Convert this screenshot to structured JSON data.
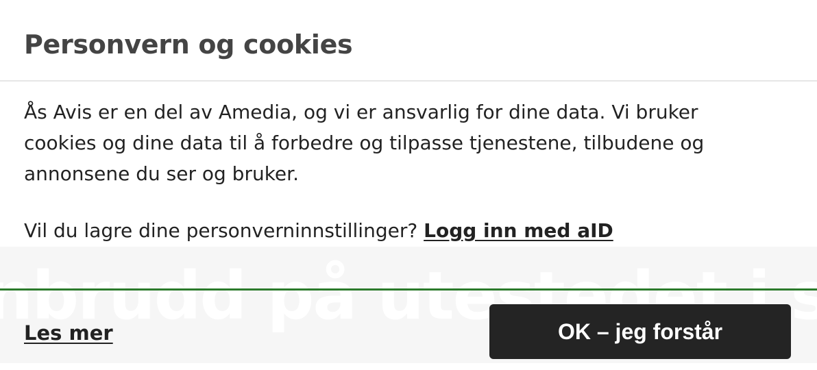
{
  "dialog": {
    "title": "Personvern og cookies",
    "intro": "Ås Avis er en del av Amedia, og vi er ansvarlig for dine data. Vi bruker cookies og dine data til å forbedre og tilpasse tjenestene, tilbudene og annonsene du ser og bruker.",
    "login_prompt": "Vil du lagre dine personverninnstillinger?",
    "login_link": "Logg inn med aID",
    "read_more": "Les mer",
    "accept_button": "OK – jeg forstår"
  },
  "background": {
    "headline": "nbrudd på utestedet i sentrum"
  },
  "colors": {
    "button_bg": "#242424",
    "accent_rule": "#2b7a2b",
    "title": "#444444",
    "text": "#222222"
  }
}
